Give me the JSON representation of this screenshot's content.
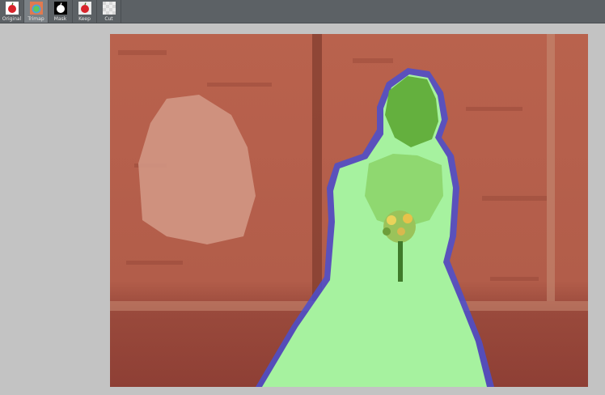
{
  "toolbar": {
    "tools": [
      {
        "label": "Original",
        "icon": "apple-red-icon"
      },
      {
        "label": "Trimap",
        "icon": "apple-trimap-icon"
      },
      {
        "label": "Mask",
        "icon": "apple-mask-icon"
      },
      {
        "label": "Keep",
        "icon": "apple-keep-icon"
      },
      {
        "label": "Cut",
        "icon": "cut-icon"
      }
    ],
    "active_index": 1
  },
  "colors": {
    "toolbar_bg": "#5c6165",
    "workspace_bg": "#c3c3c3",
    "background_overlay": "#b8614d",
    "foreground_overlay": "#a8f4a0",
    "unknown_band": "#4a4fd0"
  }
}
